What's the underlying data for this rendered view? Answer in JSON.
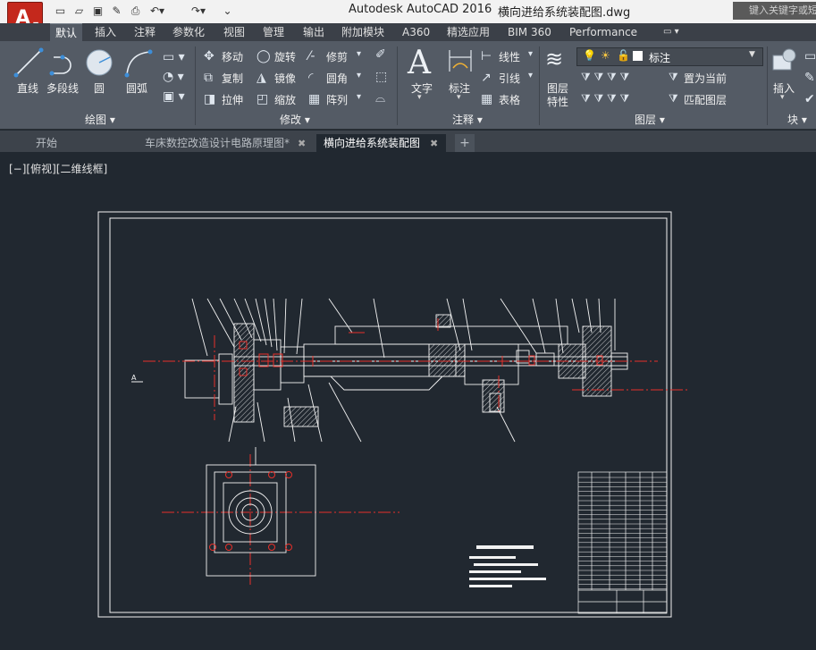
{
  "title": {
    "app_name": "Autodesk AutoCAD 2016",
    "file_name": "横向进给系统装配图.dwg",
    "search_placeholder": "键入关键字或短语"
  },
  "ribbon_tabs": [
    "默认",
    "插入",
    "注释",
    "参数化",
    "视图",
    "管理",
    "输出",
    "附加模块",
    "A360",
    "精选应用",
    "BIM 360",
    "Performance"
  ],
  "draw_panel": {
    "line": "直线",
    "polyline": "多段线",
    "circle": "圆",
    "arc": "圆弧",
    "title": "绘图"
  },
  "modify_panel": {
    "move": "移动",
    "rotate": "旋转",
    "trim": "修剪",
    "copy": "复制",
    "mirror": "镜像",
    "fillet": "圆角",
    "stretch": "拉伸",
    "scale": "缩放",
    "array": "阵列",
    "title": "修改"
  },
  "annotation_panel": {
    "text": "文字",
    "dimension": "标注",
    "leader": "引线",
    "linear": "线性",
    "table": "表格",
    "title": "注释"
  },
  "layers_panel": {
    "layer_properties_line1": "图层",
    "layer_properties_line2": "特性",
    "current_layer": "标注",
    "set_current": "置为当前",
    "match_layer": "匹配图层",
    "title": "图层"
  },
  "block_panel": {
    "insert": "插入",
    "title": "块"
  },
  "doc_tabs": {
    "start": "开始",
    "tab1": "车床数控改造设计电路原理图*",
    "tab2": "横向进给系统装配图"
  },
  "viewport_label": "[−][俯视][二维线框]",
  "colors": {
    "canvas_bg": "#212830",
    "line_white": "#f2f2f2",
    "line_red": "#e8302a",
    "ribbon_bg": "#545b65",
    "app_red": "#c4281c"
  }
}
